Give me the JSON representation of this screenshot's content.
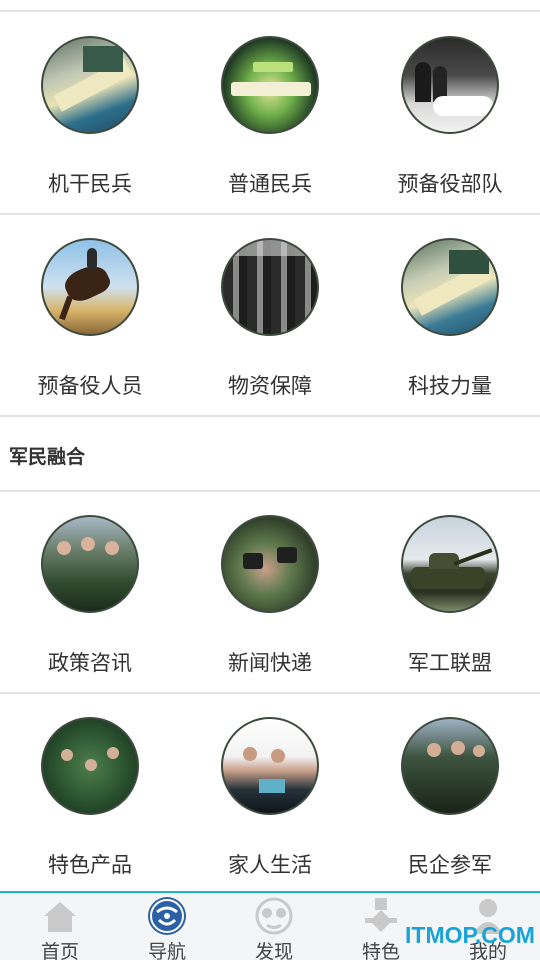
{
  "section1": {
    "rows": [
      [
        {
          "label": "机干民兵",
          "icon": "command-room-photo-icon"
        },
        {
          "label": "普通民兵",
          "icon": "sand-table-photo-icon"
        },
        {
          "label": "预备役部队",
          "icon": "officials-photo-icon"
        }
      ],
      [
        {
          "label": "预备役人员",
          "icon": "horse-rider-photo-icon"
        },
        {
          "label": "物资保障",
          "icon": "soldiers-formation-photo-icon"
        },
        {
          "label": "科技力量",
          "icon": "control-room-photo-icon"
        }
      ]
    ]
  },
  "section2": {
    "title": "军民融合",
    "rows": [
      [
        {
          "label": "政策咨讯",
          "icon": "officers-group-photo-icon"
        },
        {
          "label": "新闻快递",
          "icon": "press-crowd-photo-icon"
        },
        {
          "label": "军工联盟",
          "icon": "tank-photo-icon"
        }
      ],
      [
        {
          "label": "特色产品",
          "icon": "troops-meeting-photo-icon"
        },
        {
          "label": "家人生活",
          "icon": "family-photo-icon"
        },
        {
          "label": "民企参军",
          "icon": "generals-photo-icon"
        }
      ]
    ]
  },
  "tabbar": {
    "tabs": [
      {
        "label": "首页",
        "icon": "home-icon",
        "active": false
      },
      {
        "label": "导航",
        "icon": "navigation-icon",
        "active": true
      },
      {
        "label": "发现",
        "icon": "discover-icon",
        "active": false
      },
      {
        "label": "特色",
        "icon": "medal-icon",
        "active": false
      },
      {
        "label": "我的",
        "icon": "user-icon",
        "active": false
      }
    ]
  },
  "watermark": "ITMOP.COM",
  "colors": {
    "tab_accent": "#22b2c9",
    "active_icon": "#2b5fa6",
    "inactive_icon": "#c9c9c9",
    "watermark": "#19a3d6"
  }
}
